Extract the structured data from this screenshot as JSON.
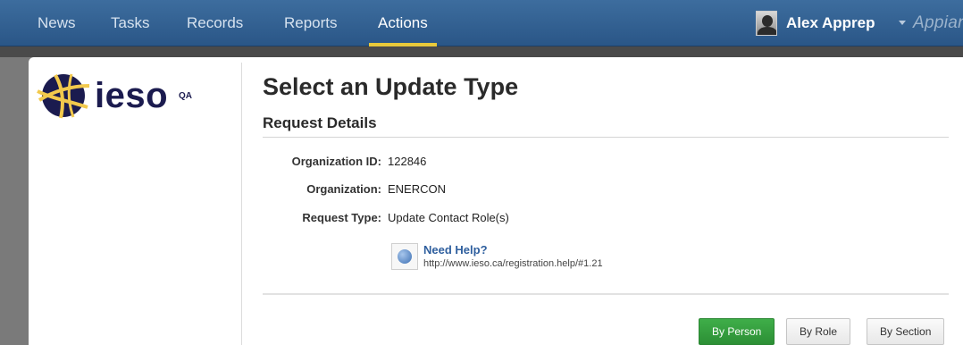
{
  "nav": {
    "items": [
      {
        "label": "News"
      },
      {
        "label": "Tasks"
      },
      {
        "label": "Records"
      },
      {
        "label": "Reports"
      },
      {
        "label": "Actions",
        "active": true
      }
    ]
  },
  "user": {
    "name": "Alex Apprep"
  },
  "brand": {
    "label": "Appian"
  },
  "logo": {
    "text": "ieso",
    "env": "QA"
  },
  "page": {
    "title": "Select an Update Type",
    "section_title": "Request Details"
  },
  "details": [
    {
      "label": "Organization ID:",
      "value": "122846"
    },
    {
      "label": "Organization:",
      "value": "ENERCON"
    },
    {
      "label": "Request Type:",
      "value": "Update Contact Role(s)"
    }
  ],
  "help": {
    "title": "Need Help?",
    "url": "http://www.ieso.ca/registration.help/#1.21"
  },
  "buttons": {
    "by_person": "By Person",
    "by_role": "By Role",
    "by_section": "By Section"
  },
  "colors": {
    "nav_bg": "#2a5687",
    "active_underline": "#e8c93b",
    "primary_button": "#3fae49",
    "link": "#2f5f9e"
  }
}
